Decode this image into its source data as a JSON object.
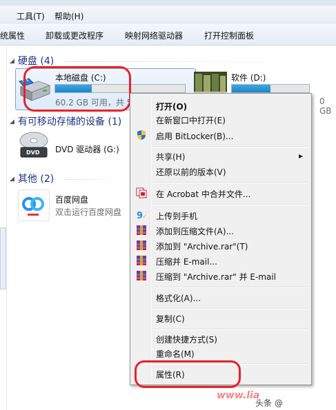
{
  "menu": {
    "tools": "工具(T)",
    "help": "帮助(H)"
  },
  "toolbar": {
    "properties": "统属性",
    "uninstall": "卸载或更改程序",
    "map_drive": "映射网络驱动器",
    "control_panel": "打开控制面板"
  },
  "groups": {
    "hdd": "硬盘 (4)",
    "removable": "有可移动存储的设备 (1)",
    "other": "其他 (2)"
  },
  "drives": {
    "c": {
      "name": "本地磁盘 (C:)",
      "info": "60.2 GB 可用，共 5",
      "used_fraction": 0.28
    },
    "d": {
      "name": "软件 (D:)",
      "info_tail": "0 GB",
      "used_fraction": 0.5
    },
    "g": {
      "name": "DVD 驱动器 (G:)"
    },
    "baidu": {
      "name": "百度网盘",
      "sub": "双击运行百度网盘"
    }
  },
  "context_menu": {
    "open": "打开(O)",
    "open_new_window": "在新窗口中打开(E)",
    "bitlocker": "启用 BitLocker(B)...",
    "share": "共享(H)",
    "restore": "还原以前的版本(V)",
    "acrobat": "在 Acrobat 中合并文件...",
    "upload_phone": "上传到手机",
    "add_archive": "添加到压缩文件(A)...",
    "add_archive_rar": "添加到 \"Archive.rar\"(T)",
    "compress_email": "压缩并 E-mail...",
    "compress_rar_email": "压缩到 \"Archive.rar\" 并 E-mail",
    "format": "格式化(A)...",
    "copy": "复制(C)",
    "shortcut": "创建快捷方式(S)",
    "rename": "重命名(M)",
    "properties": "属性(R)"
  },
  "watermark": {
    "site": "www.lia",
    "credit": "头条 @"
  }
}
